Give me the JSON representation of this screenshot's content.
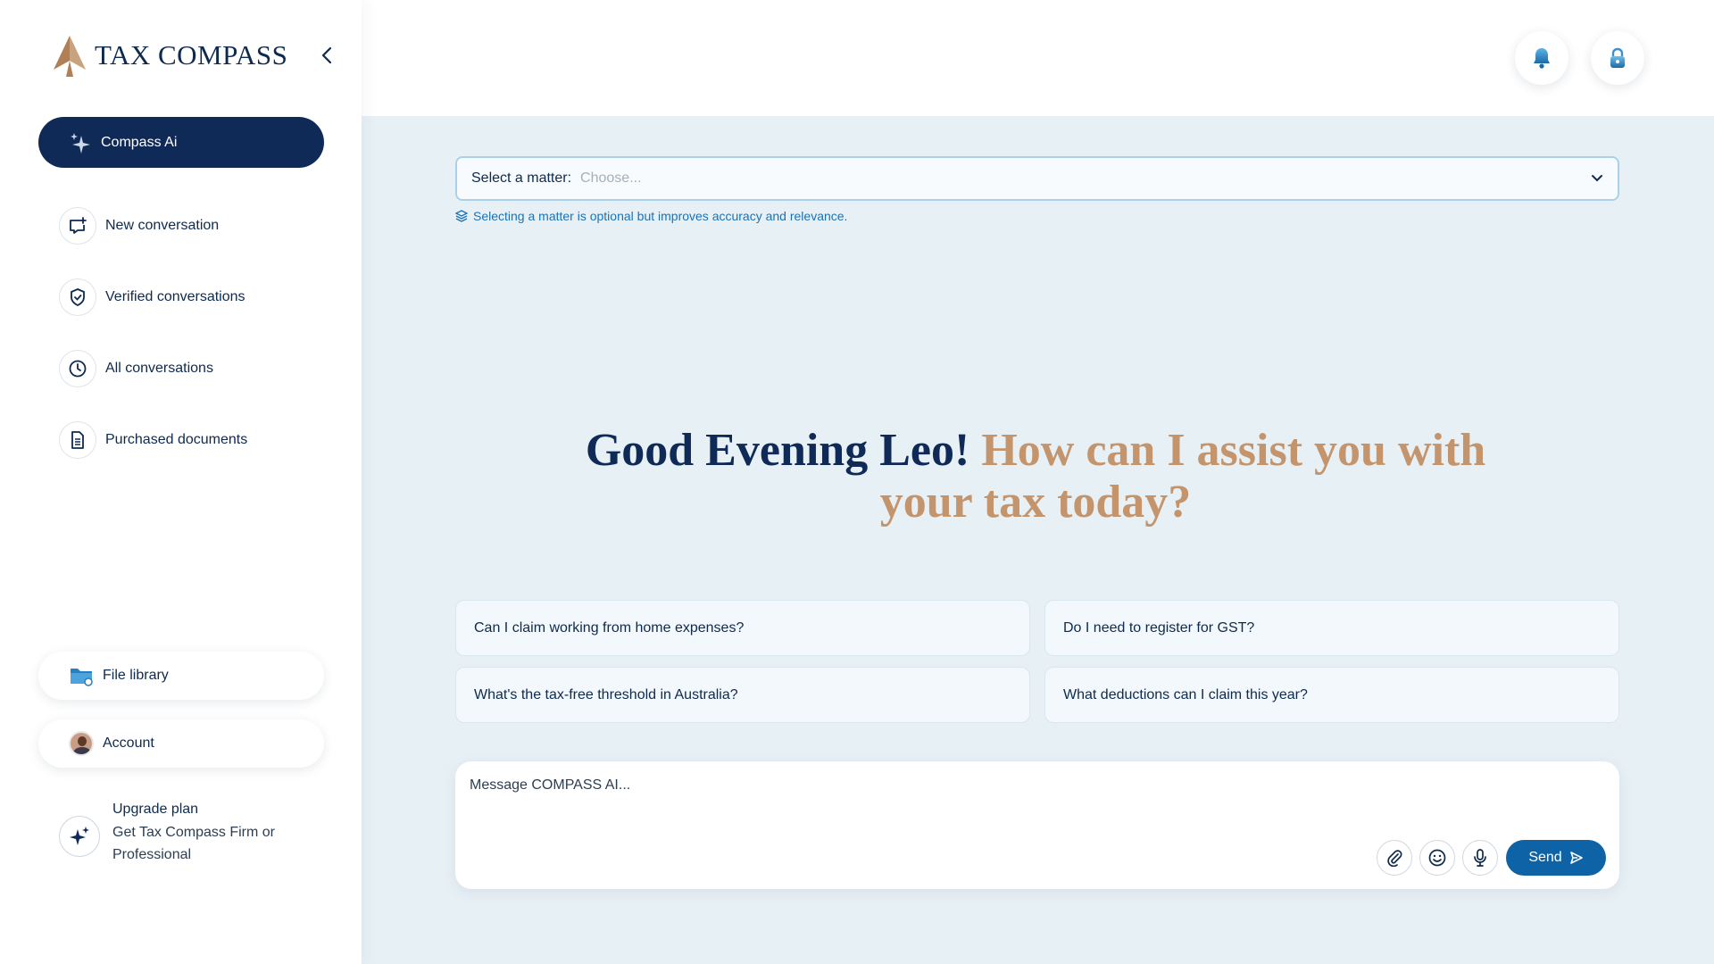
{
  "app": {
    "logo_text": "TAX COMPASS"
  },
  "sidebar": {
    "primary_button": "Compass Ai",
    "items": [
      {
        "label": "New conversation",
        "icon": "chat-plus-icon"
      },
      {
        "label": "Verified conversations",
        "icon": "shield-check-icon"
      },
      {
        "label": "All conversations",
        "icon": "clock-icon"
      },
      {
        "label": "Purchased documents",
        "icon": "document-icon"
      }
    ],
    "file_library": "File library",
    "account": "Account",
    "upgrade": {
      "title": "Upgrade plan",
      "subtitle": "Get Tax Compass Firm or Professional"
    }
  },
  "matter": {
    "label": "Select a matter:",
    "placeholder": "Choose...",
    "hint": "Selecting a matter is optional but improves accuracy and relevance."
  },
  "greeting": {
    "part1": "Good Evening Leo!",
    "part2": "How can I assist you with your tax today?"
  },
  "suggestions": [
    "Can I claim working from home expenses?",
    "Do I need to register for GST?",
    "What's the tax-free threshold in Australia?",
    "What deductions can I claim this year?"
  ],
  "composer": {
    "placeholder": "Message COMPASS AI...",
    "send_label": "Send"
  },
  "colors": {
    "navy": "#0f2a57",
    "gold": "#c4956c",
    "accent_blue": "#0d63a5",
    "background": "#e7f0f5"
  }
}
